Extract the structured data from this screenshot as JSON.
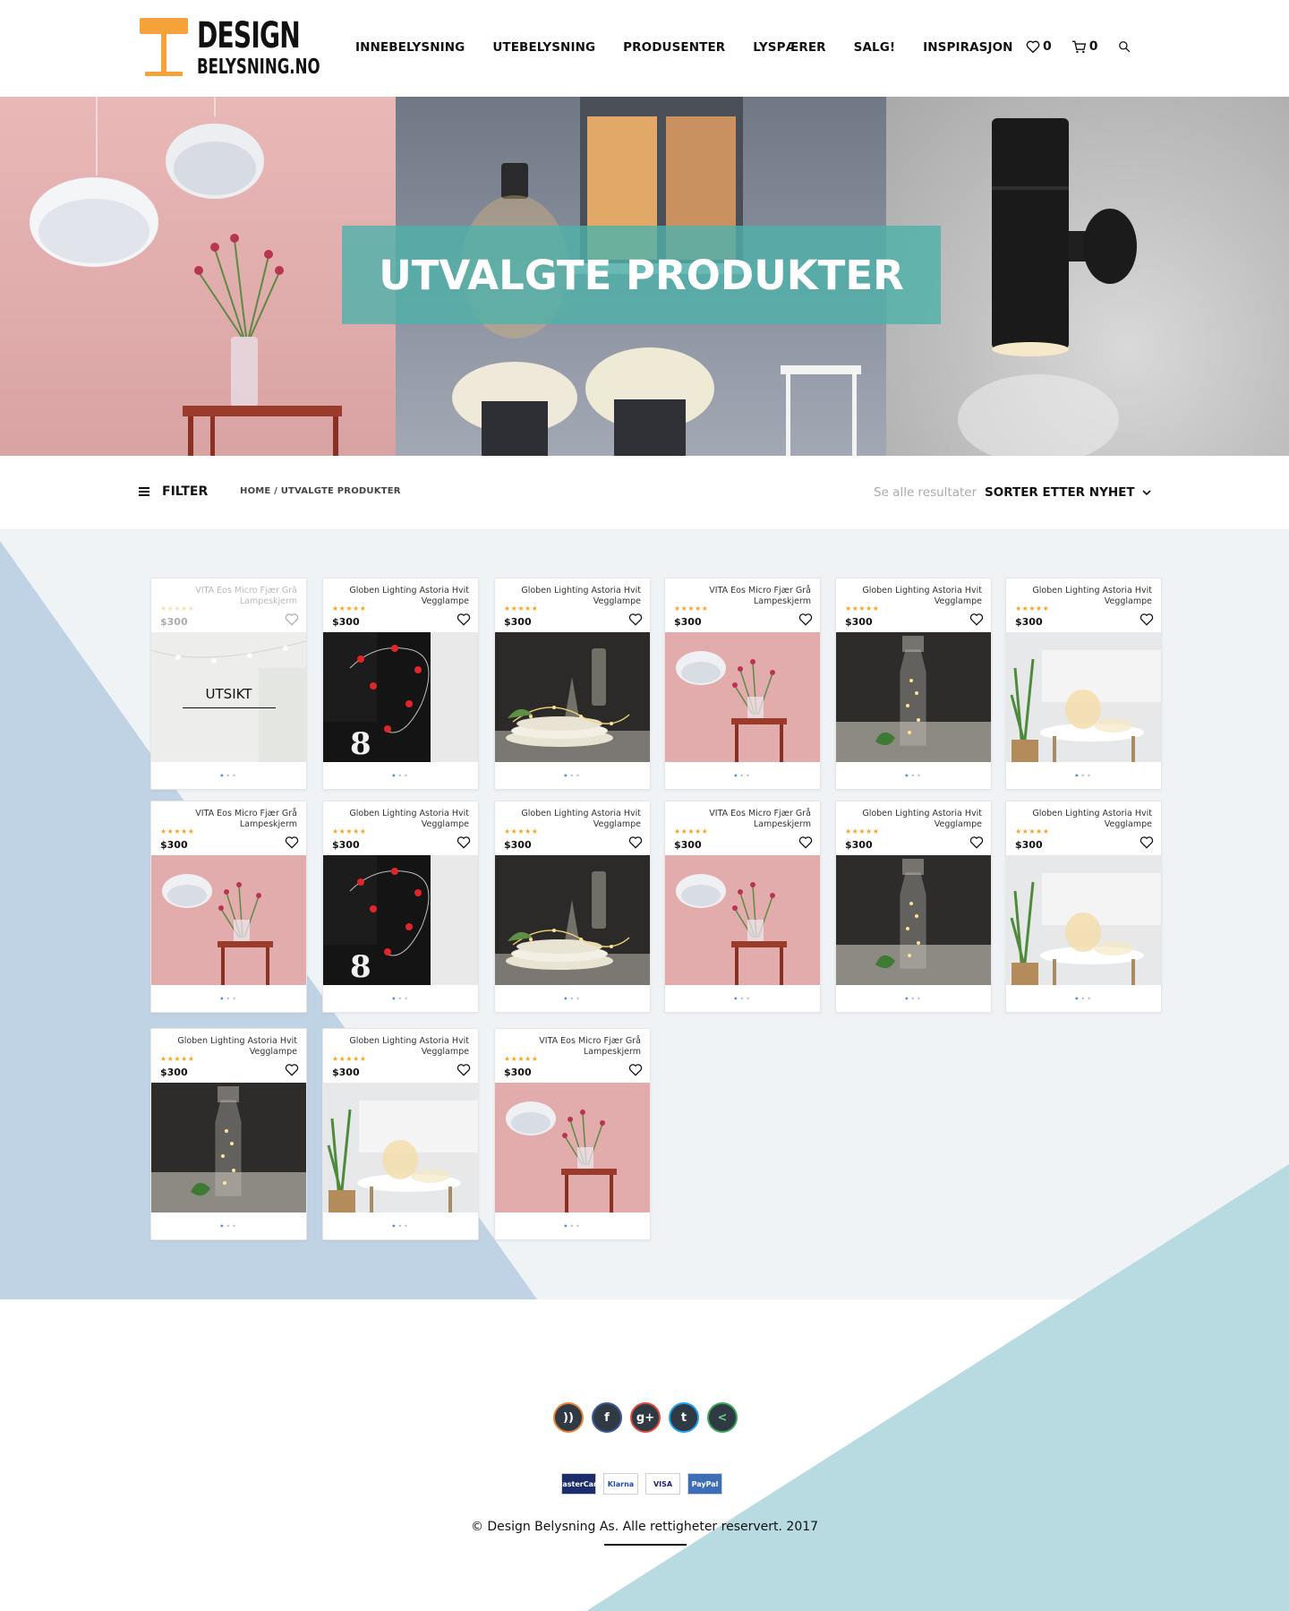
{
  "logo": {
    "line1": "DESIGN",
    "line2": "BELYSNING.NO"
  },
  "nav": [
    "INNEBELYSNING",
    "UTEBELYSNING",
    "PRODUSENTER",
    "LYSPÆRER",
    "SALG!",
    "INSPIRASJON"
  ],
  "header": {
    "wishlist_count": "0",
    "cart_count": "0"
  },
  "hero": {
    "title": "UTVALGTE PRODUKTER"
  },
  "toolbar": {
    "filter_label": "FILTER",
    "breadcrumb_home": "HOME /",
    "breadcrumb_current": "UTVALGTE PRODUKTER",
    "results_label": "Se alle resultater",
    "sort_label": "SORTER ETTER NYHET"
  },
  "products": [
    {
      "title": "VITA Eos Micro Fjær Grå Lampeskjerm",
      "price": "$300",
      "stars": "★★★★★",
      "image": "lights-string-gray",
      "overlay": "UTSIKT"
    },
    {
      "title": "Globen Lighting Astoria Hvit Vegglampe",
      "price": "$300",
      "stars": "★★★★★",
      "image": "red-hearts-lights"
    },
    {
      "title": "Globen Lighting Astoria Hvit Vegglampe",
      "price": "$300",
      "stars": "★★★★★",
      "image": "glass-plates-lights"
    },
    {
      "title": "VITA Eos Micro Fjær Grå Lampeskjerm",
      "price": "$300",
      "stars": "★★★★★",
      "image": "pink-feather-lamp"
    },
    {
      "title": "Globen Lighting Astoria Hvit Vegglampe",
      "price": "$300",
      "stars": "★★★★★",
      "image": "bottle-lights"
    },
    {
      "title": "Globen Lighting Astoria Hvit Vegglampe",
      "price": "$300",
      "stars": "★★★★★",
      "image": "living-room-lights"
    },
    {
      "title": "VITA Eos Micro Fjær Grå Lampeskjerm",
      "price": "$300",
      "stars": "★★★★★",
      "image": "pink-feather-lamp"
    },
    {
      "title": "Globen Lighting Astoria Hvit Vegglampe",
      "price": "$300",
      "stars": "★★★★★",
      "image": "red-hearts-lights"
    },
    {
      "title": "Globen Lighting Astoria Hvit Vegglampe",
      "price": "$300",
      "stars": "★★★★★",
      "image": "glass-plates-lights"
    },
    {
      "title": "VITA Eos Micro Fjær Grå Lampeskjerm",
      "price": "$300",
      "stars": "★★★★★",
      "image": "pink-feather-lamp"
    },
    {
      "title": "Globen Lighting Astoria Hvit Vegglampe",
      "price": "$300",
      "stars": "★★★★★",
      "image": "bottle-lights"
    },
    {
      "title": "Globen Lighting Astoria Hvit Vegglampe",
      "price": "$300",
      "stars": "★★★★★",
      "image": "living-room-lights"
    },
    {
      "title": "Globen Lighting Astoria Hvit Vegglampe",
      "price": "$300",
      "stars": "★★★★★",
      "image": "bottle-lights"
    },
    {
      "title": "Globen Lighting Astoria Hvit Vegglampe",
      "price": "$300",
      "stars": "★★★★★",
      "image": "living-room-lights"
    },
    {
      "title": "VITA Eos Micro Fjær Grå Lampeskjerm",
      "price": "$300",
      "stars": "★★★★★",
      "image": "pink-feather-lamp"
    }
  ],
  "footer": {
    "socials": [
      {
        "icon": "rss-icon",
        "glyph": "))",
        "color": "#e8833a"
      },
      {
        "icon": "facebook-icon",
        "glyph": "f",
        "color": "#3b5998"
      },
      {
        "icon": "google-plus-icon",
        "glyph": "g+",
        "color": "#dd4b39"
      },
      {
        "icon": "twitter-icon",
        "glyph": "t",
        "color": "#1da1f2"
      },
      {
        "icon": "share-icon",
        "glyph": "<",
        "color": "#3aa757"
      }
    ],
    "payments": [
      "MasterCard",
      "Klarna",
      "VISA",
      "PayPal"
    ],
    "copyright": "© Design Belysning As. Alle rettigheter reservert. 2017"
  },
  "colors": {
    "accent": "#4db2aa",
    "star": "#f5a623",
    "bg_light": "#f0f3f6",
    "bg_blue": "#c0d3e4",
    "footer_teal": "#b8dbe1"
  }
}
